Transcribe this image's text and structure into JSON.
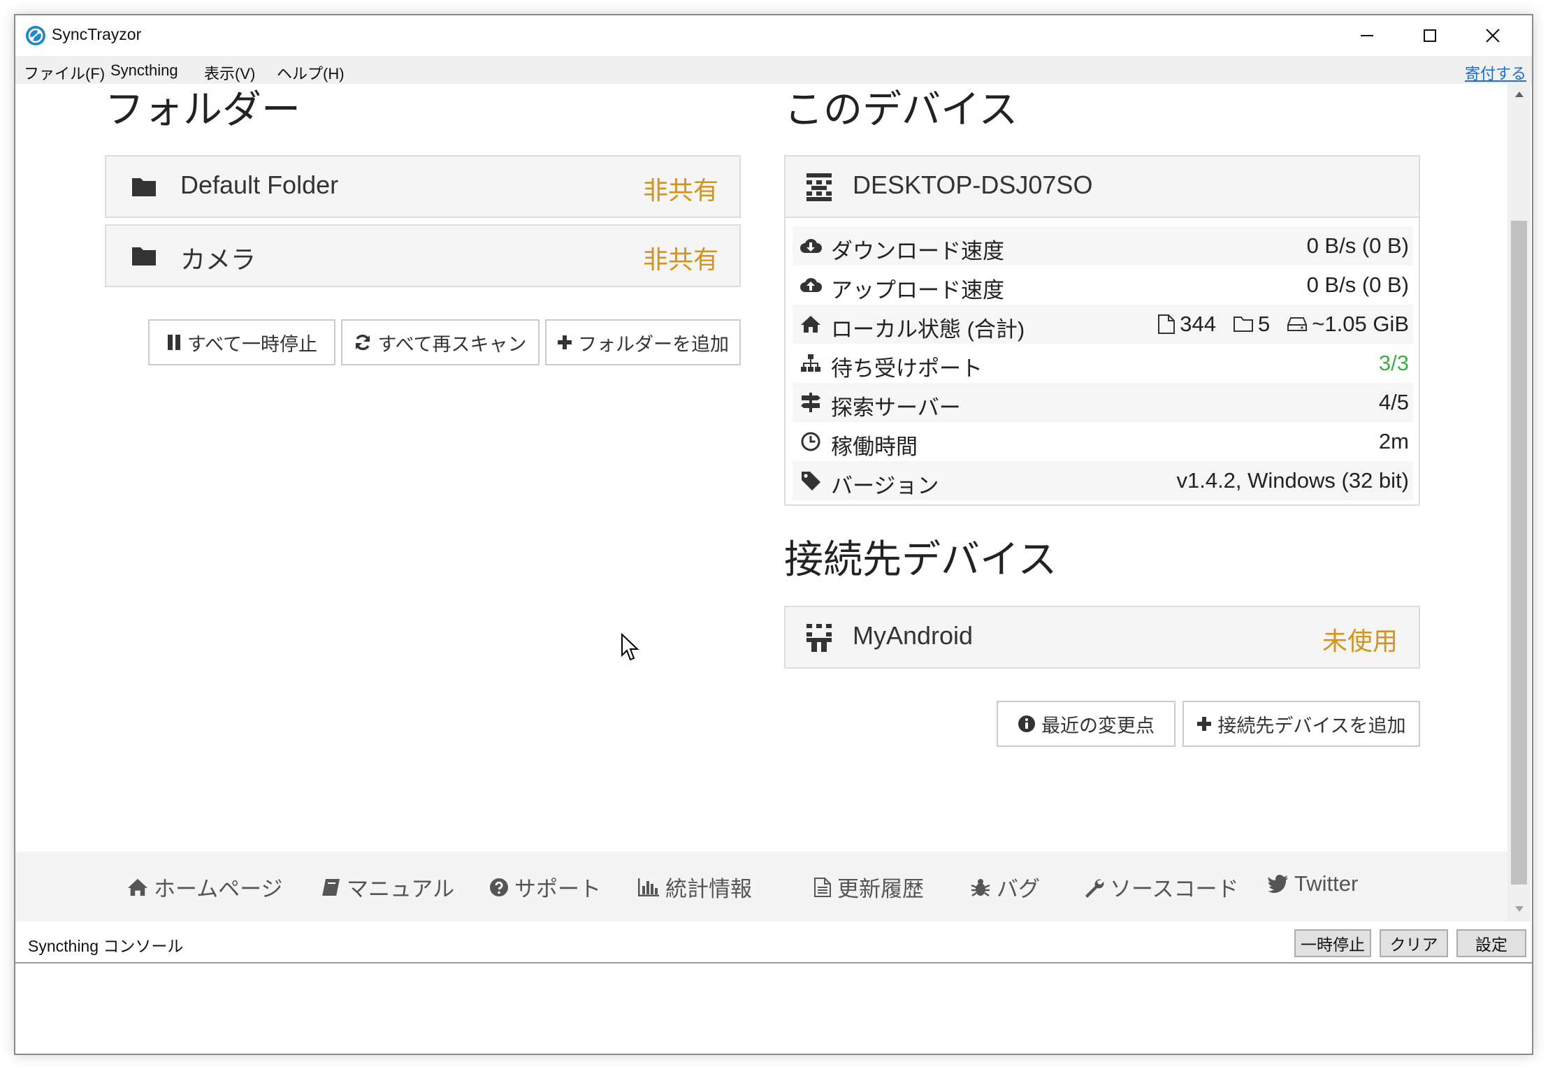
{
  "window": {
    "title": "SyncTrayzor"
  },
  "menu": {
    "items": [
      "ファイル(F)",
      "Syncthing",
      "表示(V)",
      "ヘルプ(H)"
    ],
    "donate": "寄付する"
  },
  "folders": {
    "heading": "フォルダー",
    "items": [
      {
        "name": "Default Folder",
        "status": "非共有"
      },
      {
        "name": "カメラ",
        "status": "非共有"
      }
    ],
    "buttons": {
      "pause_all": "すべて一時停止",
      "rescan_all": "すべて再スキャン",
      "add_folder": "フォルダーを追加"
    }
  },
  "this_device": {
    "heading": "このデバイス",
    "name": "DESKTOP-DSJ07SO",
    "rows": [
      {
        "icon": "cloud-download-icon",
        "label": "ダウンロード速度",
        "value": "0 B/s (0 B)"
      },
      {
        "icon": "cloud-upload-icon",
        "label": "アップロード速度",
        "value": "0 B/s (0 B)"
      },
      {
        "icon": "home-icon",
        "label": "ローカル状態 (合計)",
        "files": "344",
        "dirs": "5",
        "size": "~1.05 GiB"
      },
      {
        "icon": "sitemap-icon",
        "label": "待ち受けポート",
        "value": "3/3"
      },
      {
        "icon": "signpost-icon",
        "label": "探索サーバー",
        "value": "4/5"
      },
      {
        "icon": "clock-icon",
        "label": "稼働時間",
        "value": "2m"
      },
      {
        "icon": "tag-icon",
        "label": "バージョン",
        "value": "v1.4.2, Windows (32 bit)"
      }
    ]
  },
  "remote_devices": {
    "heading": "接続先デバイス",
    "items": [
      {
        "name": "MyAndroid",
        "status": "未使用"
      }
    ],
    "buttons": {
      "recent_changes": "最近の変更点",
      "add_device": "接続先デバイスを追加"
    }
  },
  "footer": {
    "links": [
      {
        "icon": "home-icon",
        "label": "ホームページ"
      },
      {
        "icon": "book-icon",
        "label": "マニュアル"
      },
      {
        "icon": "question-circle-icon",
        "label": "サポート"
      },
      {
        "icon": "bar-chart-icon",
        "label": "統計情報"
      },
      {
        "icon": "file-text-icon",
        "label": "更新履歴"
      },
      {
        "icon": "bug-icon",
        "label": "バグ"
      },
      {
        "icon": "wrench-icon",
        "label": "ソースコード"
      },
      {
        "icon": "twitter-icon",
        "label": "Twitter"
      }
    ]
  },
  "console": {
    "label": "Syncthing コンソール",
    "pause": "一時停止",
    "clear": "クリア",
    "settings": "設定"
  },
  "colors": {
    "status_orange": "#d4931b",
    "status_green": "#3cb043",
    "link_blue": "#1a6fd1"
  }
}
